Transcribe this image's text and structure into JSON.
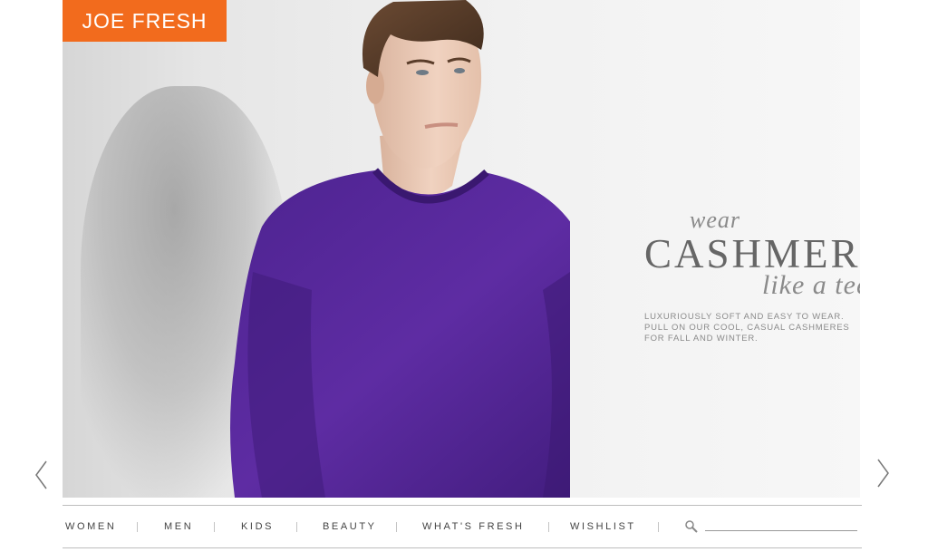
{
  "brand": {
    "logo_text": "JOE FRESH",
    "logo_color": "#f26b1d"
  },
  "hero": {
    "headline_top": "wear",
    "headline_main": "CASHMERE",
    "headline_bottom": "like a tee",
    "description_lines": [
      "LUXURIOUSLY SOFT AND EASY TO WEAR.",
      "PULL ON OUR COOL, CASUAL CASHMERES",
      "FOR FALL AND WINTER."
    ],
    "sweater_color": "#5b2a9c"
  },
  "carousel": {
    "prev_icon": "chevron-left-icon",
    "next_icon": "chevron-right-icon"
  },
  "nav": {
    "items": [
      "WOMEN",
      "MEN",
      "KIDS",
      "BEAUTY",
      "WHAT'S FRESH",
      "WISHLIST"
    ],
    "search_icon": "search-icon",
    "search_value": ""
  }
}
